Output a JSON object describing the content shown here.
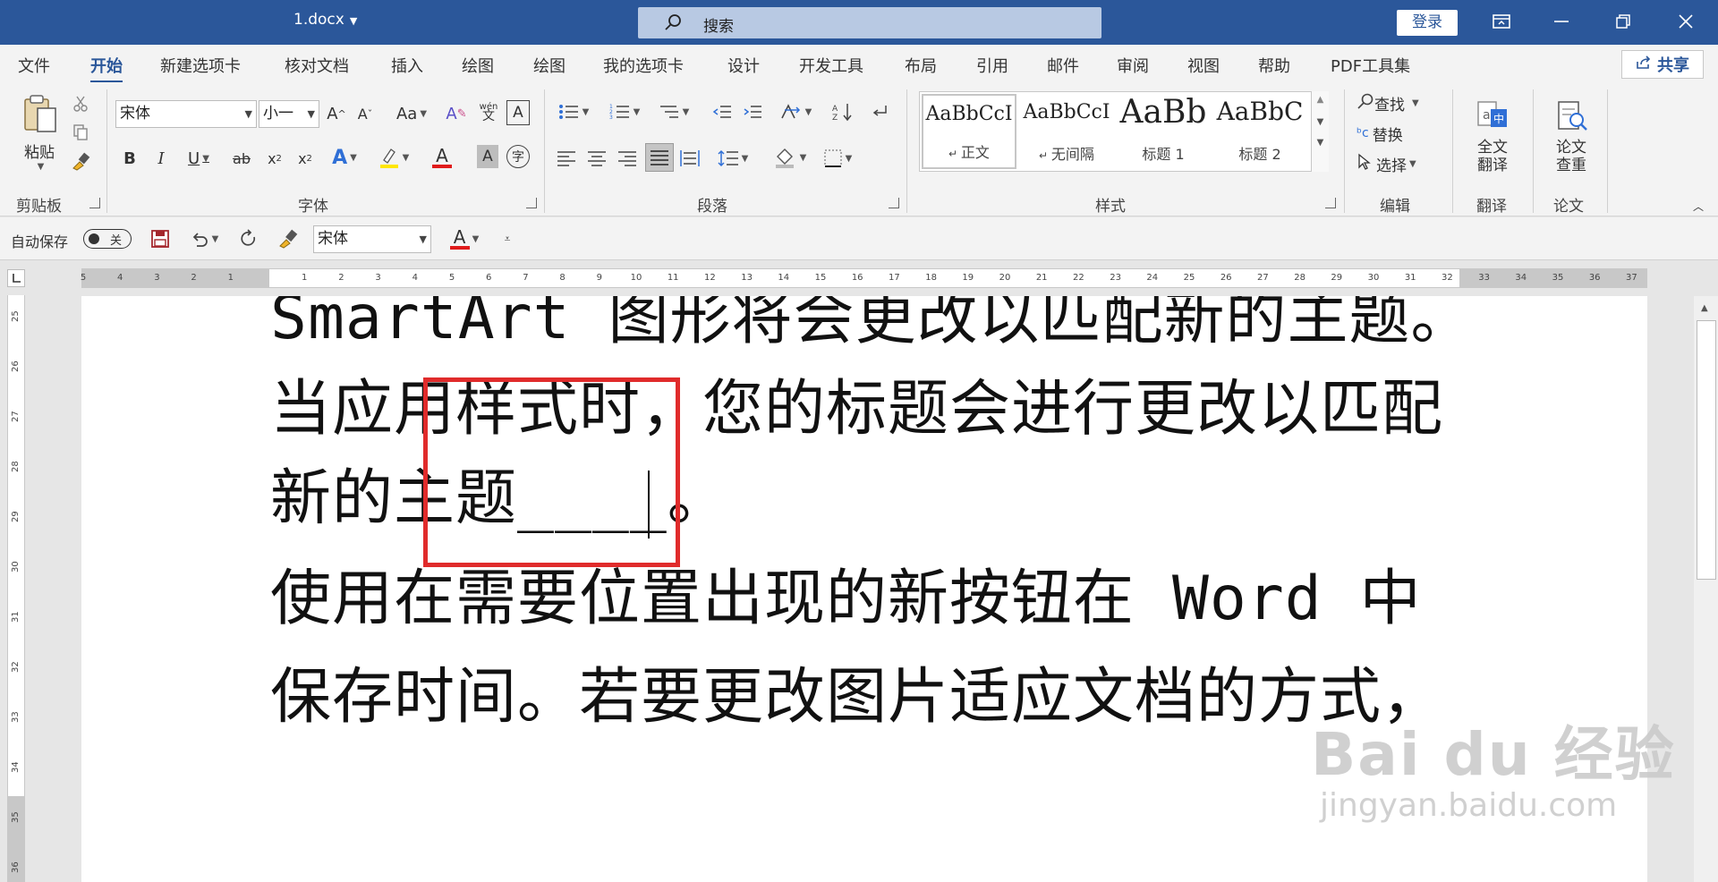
{
  "titlebar": {
    "doc_title": "1.docx",
    "search_placeholder": "搜索",
    "login_label": "登录"
  },
  "tabs": [
    {
      "label": "文件"
    },
    {
      "label": "开始"
    },
    {
      "label": "新建选项卡"
    },
    {
      "label": "核对文档"
    },
    {
      "label": "插入"
    },
    {
      "label": "绘图"
    },
    {
      "label": "绘图"
    },
    {
      "label": "我的选项卡"
    },
    {
      "label": "设计"
    },
    {
      "label": "开发工具"
    },
    {
      "label": "布局"
    },
    {
      "label": "引用"
    },
    {
      "label": "邮件"
    },
    {
      "label": "审阅"
    },
    {
      "label": "视图"
    },
    {
      "label": "帮助"
    },
    {
      "label": "PDF工具集"
    }
  ],
  "share_label": "共享",
  "ribbon": {
    "clipboard": {
      "paste_label": "粘贴",
      "group_label": "剪贴板"
    },
    "font": {
      "font_name": "宋体",
      "font_size": "小一",
      "group_label": "字体",
      "change_case": "Aa",
      "phonetic": "wén"
    },
    "paragraph": {
      "group_label": "段落"
    },
    "styles": {
      "group_label": "样式",
      "items": [
        {
          "sample": "AaBbCcI",
          "name": "正文"
        },
        {
          "sample": "AaBbCcI",
          "name": "无间隔"
        },
        {
          "sample": "AaBb",
          "name": "标题 1"
        },
        {
          "sample": "AaBbC",
          "name": "标题 2"
        }
      ]
    },
    "editing": {
      "find": "查找",
      "replace": "替换",
      "select": "选择",
      "group_label": "编辑"
    },
    "translate": {
      "button": "全文\n翻译",
      "line1": "全文",
      "line2": "翻译",
      "group_label": "翻译"
    },
    "paper": {
      "line1": "论文",
      "line2": "查重",
      "group_label": "论文"
    }
  },
  "qat": {
    "autosave_label": "自动保存",
    "autosave_state": "关",
    "font_name": "宋体"
  },
  "hruler_labels": [
    "5",
    "4",
    "3",
    "2",
    "1",
    "",
    "1",
    "2",
    "3",
    "4",
    "5",
    "6",
    "7",
    "8",
    "9",
    "10",
    "11",
    "12",
    "13",
    "14",
    "15",
    "16",
    "17",
    "18",
    "19",
    "20",
    "21",
    "22",
    "23",
    "24",
    "25",
    "26",
    "27",
    "28",
    "29",
    "30",
    "31",
    "32",
    "33",
    "34",
    "35",
    "36",
    "37"
  ],
  "vruler_labels": [
    "25",
    "26",
    "27",
    "28",
    "29",
    "30",
    "31",
    "32",
    "33",
    "34",
    "35",
    "36"
  ],
  "document": {
    "lines": [
      "SmartArt 图形将会更改以匹配新的主题。",
      "当应用样式时，您的标题会进行更改以匹配",
      "新的主题____。",
      "使用在需要位置出现的新按钮在 Word 中",
      "保存时间。若要更改图片适应文档的方式，"
    ]
  },
  "watermark": {
    "logo": "Bai du 经验",
    "url": "jingyan.baidu.com"
  },
  "colors": {
    "titlebar": "#2b579a",
    "highlight": "#e02b2b",
    "ribbon_bg": "#f3f3f3"
  }
}
